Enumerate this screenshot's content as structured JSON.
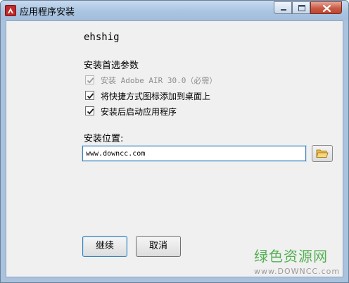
{
  "window": {
    "title": "应用程序安装",
    "app_icon": "adobe-air-icon",
    "controls": {
      "minimize": "minimize-icon",
      "maximize": "maximize-icon",
      "close": "close-icon"
    }
  },
  "app": {
    "name": "ehshig"
  },
  "preferences": {
    "heading": "安装首选参数",
    "options": [
      {
        "label": "安装 Adobe AIR 30.0（必需）",
        "checked": true,
        "disabled": true
      },
      {
        "label": "将快捷方式图标添加到桌面上",
        "checked": true,
        "disabled": false
      },
      {
        "label": "安装后启动应用程序",
        "checked": true,
        "disabled": false
      }
    ]
  },
  "location": {
    "label": "安装位置:",
    "value": "www.downcc.com",
    "browse_icon": "folder-open-icon"
  },
  "buttons": {
    "continue": "继续",
    "cancel": "取消"
  },
  "watermark": {
    "main": "绿色资源网",
    "url": "www.DOWNCC.com"
  },
  "colors": {
    "accent": "#3c7fb1",
    "watermark": "#3aa53a",
    "close": "#c75a45"
  }
}
